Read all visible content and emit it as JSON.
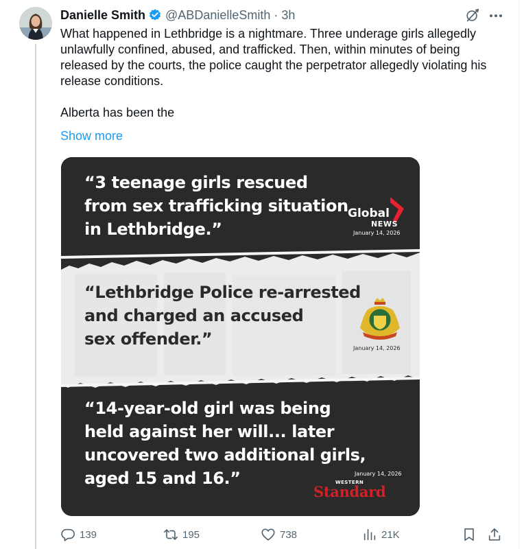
{
  "post": {
    "author_name": "Danielle Smith",
    "handle": "@ABDanielleSmith",
    "separator": "·",
    "time": "3h",
    "text_paragraph_1": "What happened in Lethbridge is a nightmare. Three underage girls allegedly unlawfully confined, abused, and trafficked. Then, within minutes of being released by the courts, the police caught the perpetrator allegedly violating his release conditions.",
    "text_paragraph_2": "Alberta has been the",
    "show_more": "Show more"
  },
  "media": {
    "quote_1": {
      "line_1": "“3 teenage girls rescued",
      "line_2": "from sex trafficking situation",
      "line_3": "in Lethbridge.”",
      "source_word_1": "Global",
      "source_word_2": "NEWS",
      "date": "January 14, 2026"
    },
    "quote_2": {
      "line_1": "“Lethbridge Police re-arrested",
      "line_2": "and charged an accused",
      "line_3": "sex offender.”",
      "date": "January 14, 2026"
    },
    "quote_3": {
      "line_1": "“14-year-old girl was being",
      "line_2": "held against her will... later",
      "line_3": "uncovered two additional girls,",
      "line_4": "aged 15 and 16.”",
      "source_word_1": "WESTERN",
      "source_word_2": "Standard",
      "date": "January 14, 2026"
    }
  },
  "actions": {
    "replies": "139",
    "reposts": "195",
    "likes": "738",
    "views": "21K"
  },
  "icons": {
    "verified": "verified-badge-icon",
    "grok": "grok-icon",
    "more": "more-icon",
    "reply": "reply-icon",
    "repost": "repost-icon",
    "like": "heart-icon",
    "views": "views-icon",
    "bookmark": "bookmark-icon",
    "share": "share-icon"
  },
  "colors": {
    "text": "#0f1419",
    "secondary_text": "#536471",
    "link": "#1d9bf0",
    "verified": "#1d9bf0",
    "media_dark": "#2b2a2b",
    "global_red": "#e8222e",
    "western_standard_red": "#d22027"
  }
}
